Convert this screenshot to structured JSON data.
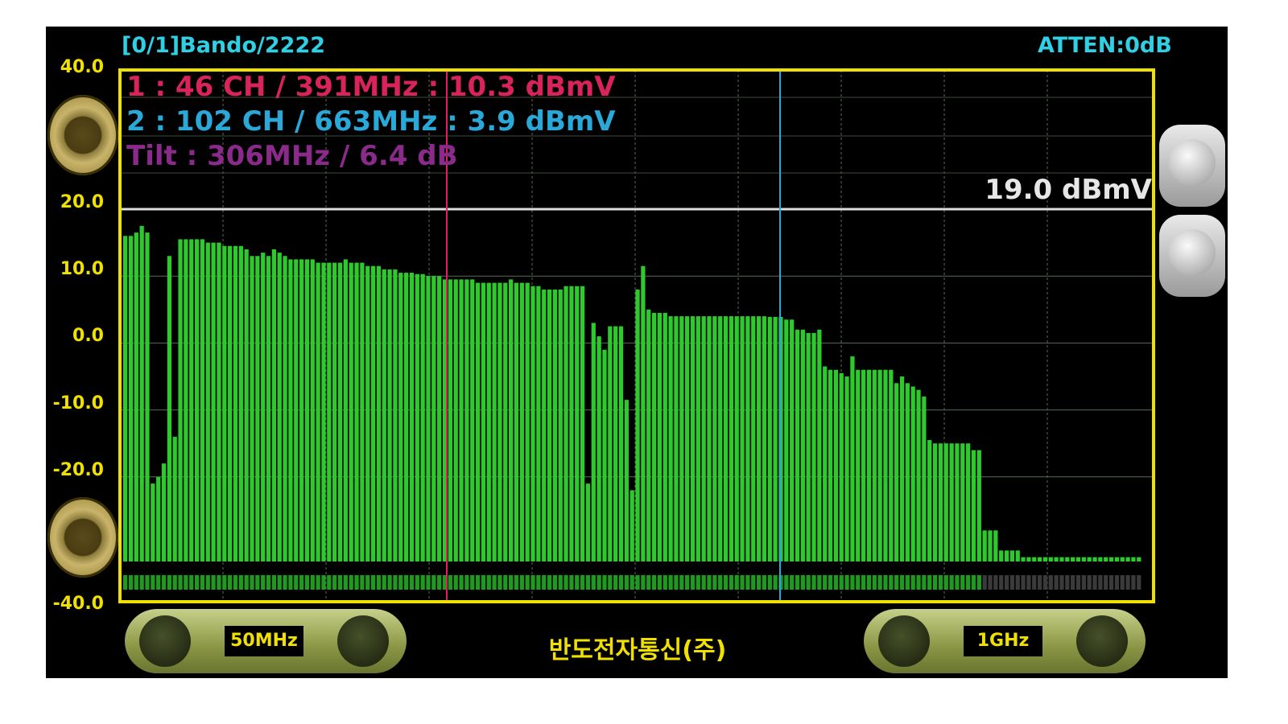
{
  "header": {
    "band_label": "[0/1]Bando/2222",
    "atten_label": "ATTEN:0dB"
  },
  "y_axis_ticks": [
    "40.0",
    "20.0",
    "10.0",
    "0.0",
    "-10.0",
    "-20.0",
    "-40.0"
  ],
  "markers": {
    "m1": "1 : 46 CH / 391MHz : 10.3 dBmV",
    "m2": "2 : 102 CH / 663MHz : 3.9 dBmV",
    "tilt": "Tilt : 306MHz / 6.4 dB",
    "ref_level": "19.0 dBmV"
  },
  "controls": {
    "start_freq": "50MHz",
    "stop_freq": "1GHz"
  },
  "company": "반도전자통신(주)",
  "colors": {
    "bars": "#2dc92d",
    "frame": "#f0e000",
    "marker1": "#d8245a",
    "marker2": "#2aa8d8",
    "tilt": "#8a2a8a",
    "header": "#2fd0e4"
  },
  "chart_data": {
    "type": "bar",
    "title": "",
    "xlabel": "",
    "ylabel": "dBmV",
    "x_range_label": [
      "50MHz",
      "1GHz"
    ],
    "y_ticks": [
      40,
      20,
      10,
      0,
      -10,
      -20,
      -40
    ],
    "ref_level": 19.0,
    "grid": true,
    "values": [
      16,
      16,
      16.5,
      17.5,
      16.5,
      -21,
      -20,
      -18,
      13,
      -14,
      15.5,
      15.5,
      15.5,
      15.5,
      15.5,
      15,
      15,
      15,
      14.5,
      14.5,
      14.5,
      14.5,
      14,
      13,
      13,
      13.5,
      13,
      14,
      13.5,
      13,
      12.5,
      12.5,
      12.5,
      12.5,
      12.5,
      12,
      12,
      12,
      12,
      12,
      12.5,
      12,
      12,
      12,
      11.5,
      11.5,
      11.5,
      11,
      11,
      11,
      10.5,
      10.5,
      10.5,
      10.3,
      10.3,
      10,
      10,
      10,
      9.5,
      9.5,
      9.5,
      9.5,
      9.5,
      9.5,
      9,
      9,
      9,
      9,
      9,
      9,
      9.5,
      9,
      9,
      9,
      8.5,
      8.5,
      8,
      8,
      8,
      8,
      8.5,
      8.5,
      8.5,
      8.5,
      -21,
      3,
      1,
      -1,
      2.5,
      2.5,
      2.5,
      -8.5,
      -22,
      8,
      11.5,
      5,
      4.5,
      4.5,
      4.5,
      4,
      4,
      4,
      4,
      4,
      4,
      4,
      4,
      4,
      4,
      4,
      4,
      4,
      4,
      4,
      4,
      4,
      4,
      3.9,
      3.9,
      3.9,
      3.5,
      3.5,
      2,
      2,
      1.5,
      1.5,
      2,
      -3.5,
      -4,
      -4,
      -4.5,
      -5,
      -2,
      -4,
      -4,
      -4,
      -4,
      -4,
      -4,
      -4,
      -6,
      -5,
      -6,
      -6.5,
      -7,
      -8,
      -14.5,
      -15,
      -15,
      -15,
      -15,
      -15,
      -15,
      -15,
      -16,
      -16,
      -28,
      -28,
      -28,
      -31,
      -31,
      -31,
      -31,
      -32,
      -32,
      -32,
      -32,
      -32,
      -32,
      -32,
      -32,
      -32,
      -32,
      -32,
      -32,
      -32,
      -32,
      -32,
      -32,
      -32,
      -32,
      -32,
      -32,
      -32,
      -32
    ],
    "marker1": {
      "channel": 46,
      "freq_mhz": 391,
      "level_dbmv": 10.3
    },
    "marker2": {
      "channel": 102,
      "freq_mhz": 663,
      "level_dbmv": 3.9
    },
    "tilt": {
      "freq_mhz": 306,
      "db": 6.4
    }
  }
}
